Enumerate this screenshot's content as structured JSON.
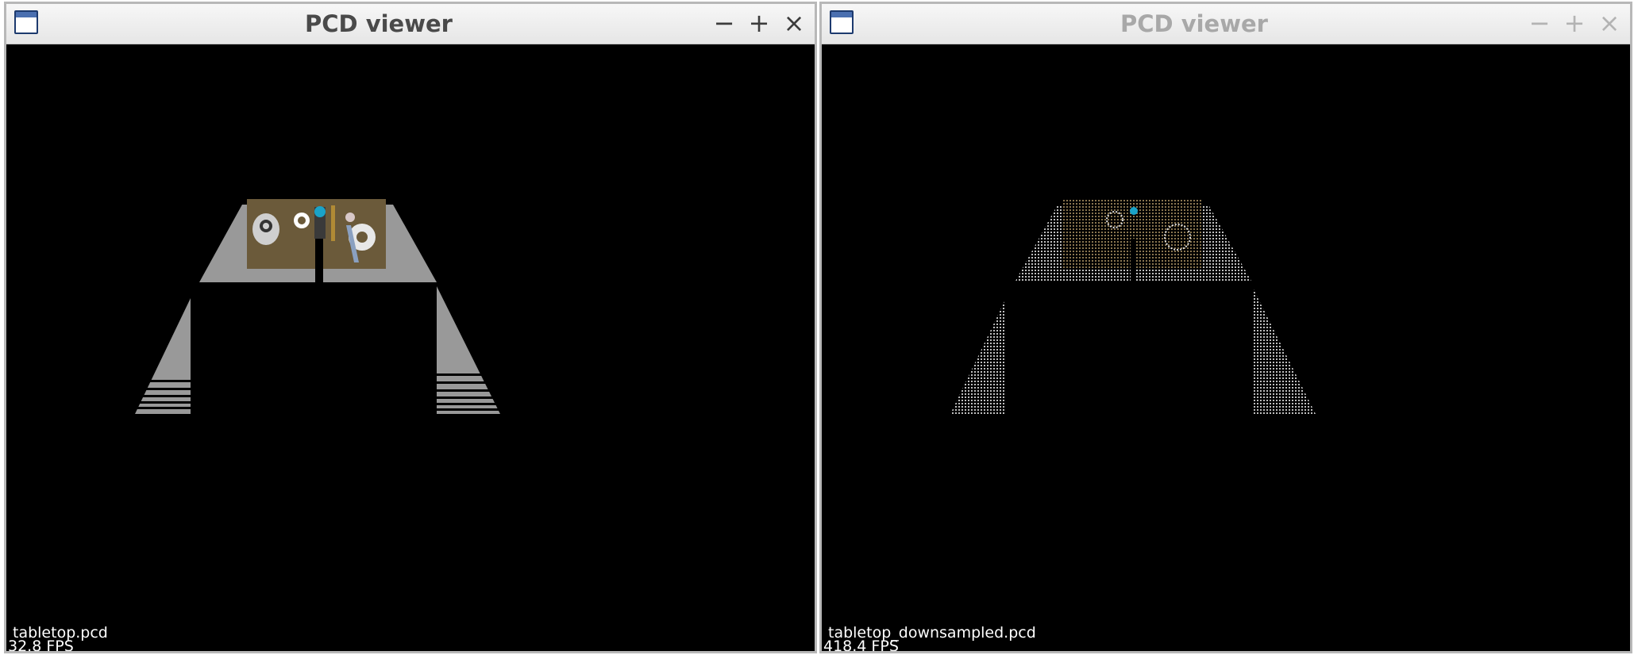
{
  "windows": [
    {
      "title": "PCD viewer",
      "controls": {
        "minimize": "−",
        "maximize": "+",
        "close": "×"
      },
      "file_label": "tabletop.pcd",
      "fps_label": "32.8 FPS",
      "state": "active"
    },
    {
      "title": "PCD viewer",
      "controls": {
        "minimize": "−",
        "maximize": "+",
        "close": "×"
      },
      "file_label": "tabletop_downsampled.pcd",
      "fps_label": "418.4 FPS",
      "state": "inactive"
    }
  ],
  "colors": {
    "background": "#000000",
    "table": "#999999",
    "board": "#6b5a3a",
    "text": "#ffffff",
    "title_active": "#4a4a4a",
    "title_inactive": "#a8a8a8"
  }
}
